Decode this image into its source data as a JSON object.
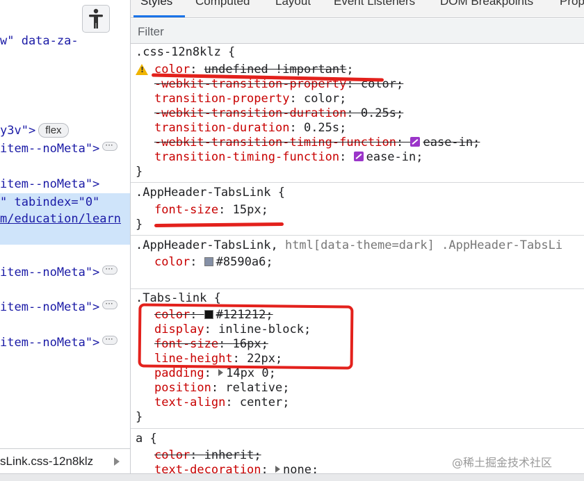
{
  "left": {
    "lines": [
      {
        "text": "w\" data-za-"
      },
      {
        "text": "y3v\">",
        "pill": "flex"
      },
      {
        "text": "item--noMeta\">"
      },
      {
        "text": "item--noMeta\">"
      },
      {
        "text": "\" tabindex=\"0\""
      },
      {
        "text": "m/education/learn"
      },
      {
        "text": "item--noMeta\">"
      },
      {
        "text": "item--noMeta\">"
      },
      {
        "text": "item--noMeta\">"
      }
    ],
    "breadcrumb": "sLink.css-12n8klz"
  },
  "tabs": [
    "Styles",
    "Computed",
    "Layout",
    "Event Listeners",
    "DOM Breakpoints",
    "Prop"
  ],
  "filter_placeholder": "Filter",
  "rules": [
    {
      "selector": ".css-12n8klz {",
      "decls": [
        {
          "prop": "color",
          "val": "undefined !important",
          "warn": true,
          "struck_val": true
        },
        {
          "prop": "-webkit-transition-property",
          "val": "color",
          "struck": true
        },
        {
          "prop": "transition-property",
          "val": "color"
        },
        {
          "prop": "-webkit-transition-duration",
          "val": "0.25s",
          "struck": true
        },
        {
          "prop": "transition-duration",
          "val": "0.25s"
        },
        {
          "prop": "-webkit-transition-timing-function",
          "val": "ease-in",
          "struck": true,
          "ease": true
        },
        {
          "prop": "transition-timing-function",
          "val": "ease-in",
          "ease": true
        }
      ]
    },
    {
      "selector": ".AppHeader-TabsLink {",
      "decls": [
        {
          "prop": "font-size",
          "val": "15px"
        }
      ]
    },
    {
      "selector": ".AppHeader-TabsLink,",
      "selector_dim": "html[data-theme=dark] .AppHeader-TabsLi",
      "decls": [
        {
          "prop": "color",
          "val": "#8590a6",
          "swatch": "#8590a6"
        }
      ]
    },
    {
      "selector": ".Tabs-link {",
      "decls": [
        {
          "prop": "color",
          "val": "#121212",
          "struck": true,
          "swatch": "#121212"
        },
        {
          "prop": "display",
          "val": "inline-block"
        },
        {
          "prop": "font-size",
          "val": "16px",
          "struck": true
        },
        {
          "prop": "line-height",
          "val": "22px"
        },
        {
          "prop": "padding",
          "val": "14px 0",
          "tri": true
        },
        {
          "prop": "position",
          "val": "relative"
        },
        {
          "prop": "text-align",
          "val": "center"
        }
      ]
    },
    {
      "selector": "a {",
      "decls": [
        {
          "prop": "color",
          "val": "inherit",
          "struck": true
        },
        {
          "prop": "text-decoration",
          "val": "none",
          "tri": true
        }
      ]
    }
  ],
  "closing_brace": "}",
  "watermark": "@稀土掘金技术社区",
  "colors": {
    "property": "#c80000",
    "annotation": "#e3211c",
    "selection": "#cfe4fa"
  }
}
